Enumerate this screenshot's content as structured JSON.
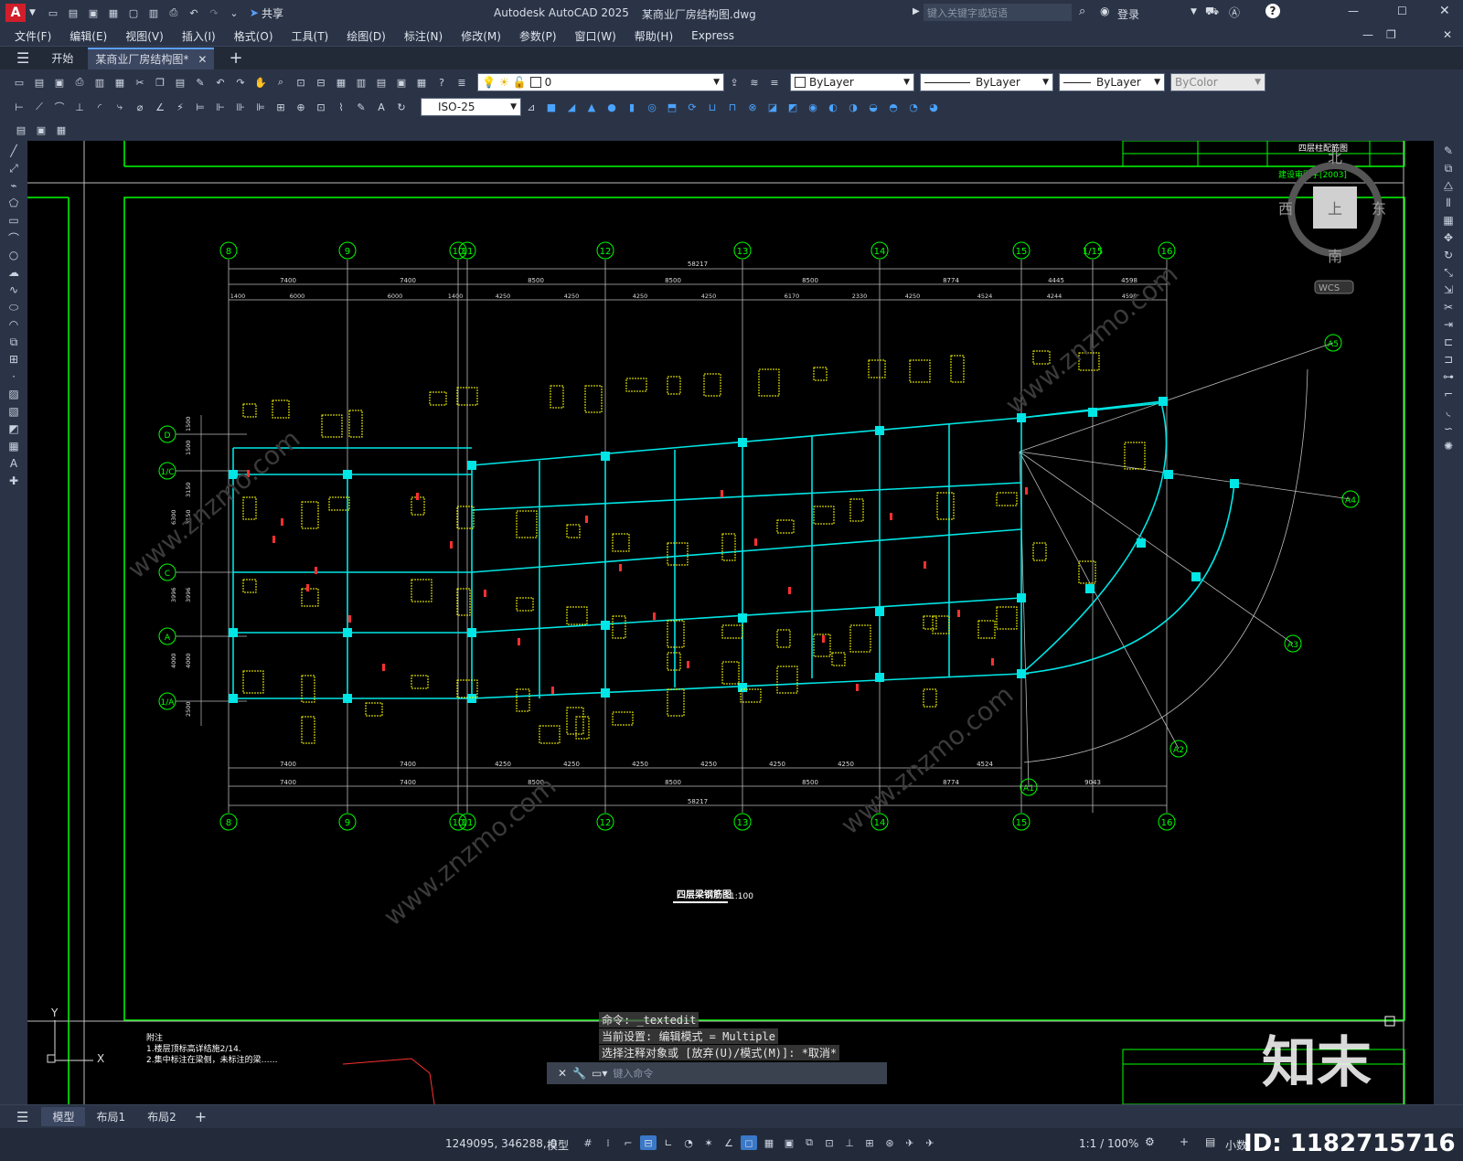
{
  "title": {
    "app": "Autodesk AutoCAD 2025",
    "file": "某商业厂房结构图.dwg",
    "search_placeholder": "键入关键字或短语",
    "login": "登录",
    "share": "共享"
  },
  "menu": [
    "文件(F)",
    "编辑(E)",
    "视图(V)",
    "插入(I)",
    "格式(O)",
    "工具(T)",
    "绘图(D)",
    "标注(N)",
    "修改(M)",
    "参数(P)",
    "窗口(W)",
    "帮助(H)",
    "Express"
  ],
  "tabs": {
    "start": "开始",
    "doc": "某商业厂房结构图*"
  },
  "toolbar": {
    "layer_value": "0",
    "color": "ByLayer",
    "linetype": "ByLayer",
    "lineweight": "ByLayer",
    "plotstyle": "ByColor",
    "dimstyle": "ISO-25"
  },
  "viewcube": {
    "north": "北",
    "south": "南",
    "east": "东",
    "west": "西",
    "top": "上",
    "wcs": "WCS"
  },
  "drawing": {
    "grid_top": [
      "8",
      "9",
      "10",
      "11",
      "12",
      "13",
      "14",
      "15",
      "1/15",
      "16"
    ],
    "grid_bottom": [
      "8",
      "9",
      "10",
      "11",
      "12",
      "13",
      "14",
      "15",
      "16"
    ],
    "grid_left": [
      "D",
      "1/C",
      "C",
      "A",
      "1/A"
    ],
    "grid_radial": [
      "A5",
      "A4",
      "A3",
      "A2",
      "A1"
    ],
    "dims_top_total": "58217",
    "dims_top_row1": [
      "7400",
      "7400",
      "8500",
      "8500",
      "8500",
      "8774",
      "4445",
      "4598"
    ],
    "dims_top_row2": [
      "1400",
      "6000",
      "6000",
      "1400",
      "4250",
      "4250",
      "4250",
      "4250",
      "6170",
      "2330",
      "4250",
      "4524",
      "4244",
      "4598"
    ],
    "dims_bottom_row1": [
      "7400",
      "7400",
      "4250",
      "4250",
      "4250",
      "4250",
      "4250",
      "4250",
      "4524"
    ],
    "dims_bottom_row2": [
      "7400",
      "7400",
      "8500",
      "8500",
      "8500",
      "8774",
      "9043"
    ],
    "dims_bottom_total": "58217",
    "dims_left": [
      "1500",
      "1500",
      "3150",
      "3150",
      "6300",
      "3996",
      "3996",
      "4000",
      "4000",
      "2500"
    ],
    "drawing_title": "四层梁钢筋图",
    "scale": "1:100",
    "titleblock_top": "四层柱配筋图",
    "titleblock_code": "建设审图字[2003]",
    "notes": [
      "附注",
      "1.楼层顶标高详结施2/14.",
      "2.集中标注在梁侧，未标注的梁……"
    ],
    "ucs_y": "Y",
    "ucs_x": "X"
  },
  "commands": [
    "命令: _textedit",
    "当前设置: 编辑模式 = Multiple",
    "选择注释对象或 [放弃(U)/模式(M)]: *取消*"
  ],
  "command_placeholder": "键入命令",
  "layouts": [
    "模型",
    "布局1",
    "布局2"
  ],
  "status": {
    "coords": "1249095, 346288, 0",
    "model": "模型",
    "scale": "1:1 / 100%",
    "units": "小数"
  },
  "watermark": {
    "brand": "知末",
    "id": "ID: 1182715716",
    "site": "www.znzmo.com"
  }
}
